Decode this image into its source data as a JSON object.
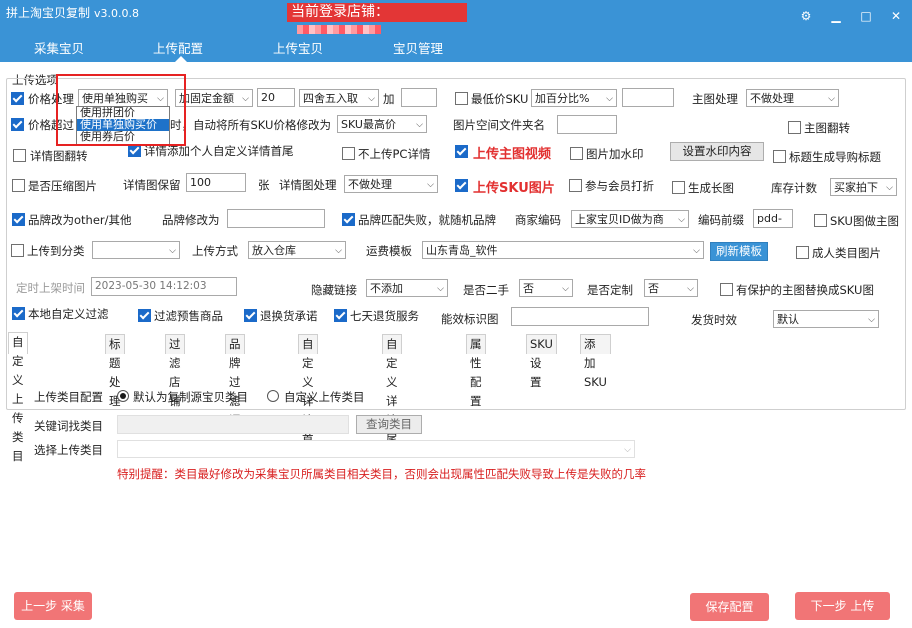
{
  "app": {
    "title": "拼上淘宝贝复制",
    "version": "v3.0.0.8",
    "store_label": "当前登录店铺："
  },
  "nav": [
    "采集宝贝",
    "上传配置",
    "上传宝贝",
    "宝贝管理"
  ],
  "group_title": "上传选项",
  "row1": {
    "price_label": "价格处理",
    "price_select": "使用单独购买",
    "fixed_select": "加固定金额",
    "fixed_value": "20",
    "round_select": "四舍五入取",
    "add_label": "加",
    "min_sku_label": "最低价SKU",
    "pct_select": "加百分比%",
    "main_img_label": "主图处理",
    "main_img_select": "不做处理"
  },
  "row2": {
    "price_over": "价格超过",
    "auto_text": "时，自动将所有SKU价格修改为",
    "sku_select": "SKU最高价",
    "folder_label": "图片空间文件夹名",
    "main_flip": "主图翻转"
  },
  "row3": {
    "detail_flip": "详情图翻转",
    "detail_add": "详情添加个人自定义详情首尾",
    "no_pc": "不上传PC详情",
    "main_video": "上传主图视频",
    "watermark": "图片加水印",
    "watermark_btn": "设置水印内容",
    "title_guide": "标题生成导购标题"
  },
  "row4": {
    "compress": "是否压缩图片",
    "keep_label": "详情图保留",
    "keep_value": "100",
    "unit": "张",
    "detail_proc": "详情图处理",
    "detail_select": "不做处理",
    "sku_img": "上传SKU图片",
    "member": "参与会员打折",
    "long_img": "生成长图",
    "stock_label": "库存计数",
    "stock_select": "买家拍下"
  },
  "row5": {
    "brand_other": "品牌改为other/其他",
    "brand_change": "品牌修改为",
    "brand_match": "品牌匹配失败，就随机品牌",
    "merchant_code": "商家编码",
    "merchant_select": "上家宝贝ID做为商",
    "code_prefix": "编码前缀",
    "code_prefix_value": "pdd-",
    "sku_main": "SKU图做主图"
  },
  "row6": {
    "upload_cat": "上传到分类",
    "method_label": "上传方式",
    "method_select": "放入仓库",
    "freight_label": "运费模板",
    "freight_select": "山东青岛_软件",
    "refresh_btn": "刷新模板",
    "adult_cat": "成人类目图片"
  },
  "row7": {
    "schedule": "定时上架时间",
    "schedule_value": "2023-05-30  14:12:03",
    "hidden_link": "隐藏链接",
    "hidden_select": "不添加",
    "second_hand": "是否二手",
    "second_select": "否",
    "custom_made": "是否定制",
    "custom_select": "否",
    "protected_main": "有保护的主图替换成SKU图"
  },
  "row8": {
    "local_filter": "本地自定义过滤",
    "pre_sale": "过滤预售商品",
    "return_promise": "退换货承诺",
    "seven_days": "七天退货服务",
    "efficacy_label": "能效标识图",
    "delivery_label": "发货时效",
    "delivery_select": "默认"
  },
  "tabs": [
    "自定义上传类目",
    "标题处理",
    "过滤店铺",
    "品牌过滤词",
    "自定义详情首",
    "自定义详情尾",
    "属性配置",
    "SKU设置",
    "添加SKU"
  ],
  "cat": {
    "config_label": "上传类目配置",
    "opt_default": "默认为复制源宝贝类目",
    "opt_custom": "自定义上传类目",
    "keyword_label": "关键词找类目",
    "query_btn": "查询类目",
    "select_label": "选择上传类目",
    "warning": "特别提醒：类目最好修改为采集宝贝所属类目相关类目，否则会出现属性匹配失败导致上传是失败的几率"
  },
  "dropdown": {
    "items": [
      "使用拼团价",
      "使用单独购买价",
      "使用券后价"
    ],
    "highlighted": 1
  },
  "footer": {
    "prev": "上一步 采集",
    "save": "保存配置",
    "next": "下一步 上传"
  },
  "colors": {
    "titlebar": "#3a93d6",
    "accent_red": "#e23030",
    "footer_btn": "#f17576"
  }
}
